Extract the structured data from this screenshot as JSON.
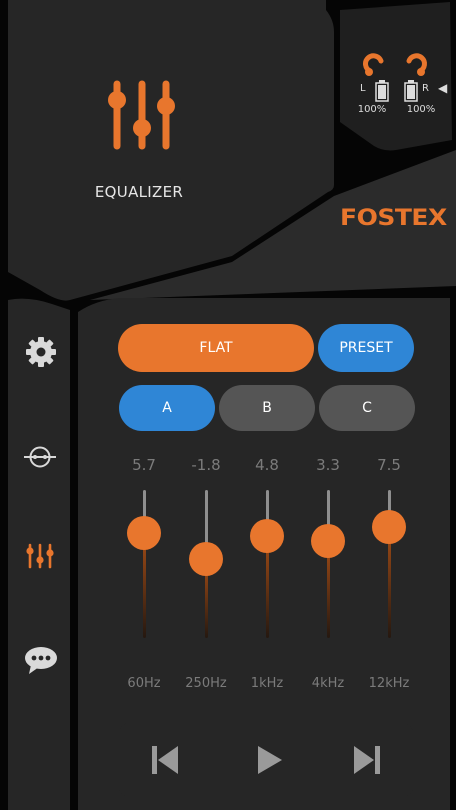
{
  "header": {
    "section_title": "EQUALIZER",
    "brand": "FOSTEX",
    "battery": {
      "left_label": "L",
      "left_level": "100%",
      "right_label": "R",
      "right_level": "100%"
    }
  },
  "sidebar": {
    "items": [
      {
        "name": "settings",
        "icon": "gear-icon",
        "active": false
      },
      {
        "name": "connection",
        "icon": "crosshair-icon",
        "active": false
      },
      {
        "name": "equalizer",
        "icon": "equalizer-icon",
        "active": true
      },
      {
        "name": "messages",
        "icon": "chat-icon",
        "active": false
      }
    ]
  },
  "equalizer": {
    "flat_label": "FLAT",
    "preset_label": "PRESET",
    "memory_slots": [
      "A",
      "B",
      "C"
    ],
    "selected_memory": "A",
    "bands": [
      {
        "freq": "60Hz",
        "gain": "5.7"
      },
      {
        "freq": "250Hz",
        "gain": "-1.8"
      },
      {
        "freq": "1kHz",
        "gain": "4.8"
      },
      {
        "freq": "4kHz",
        "gain": "3.3"
      },
      {
        "freq": "12kHz",
        "gain": "7.5"
      }
    ],
    "gain_range": [
      -10,
      10
    ]
  },
  "transport": {
    "buttons": [
      "skip-previous-icon",
      "play-icon",
      "skip-next-icon"
    ]
  },
  "colors": {
    "accent_orange": "#e8762d",
    "accent_blue": "#2f86d6",
    "panel": "#262626",
    "inactive_button": "#555555"
  }
}
